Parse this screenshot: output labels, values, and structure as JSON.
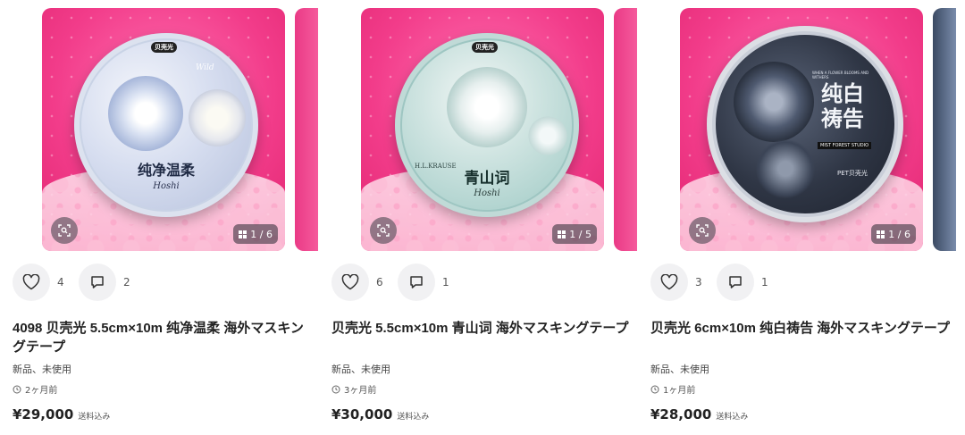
{
  "items": [
    {
      "likes": "4",
      "comments": "2",
      "title": "4098 贝壳光 5.5cm×10m 纯净温柔 海外マスキングテープ",
      "condition": "新品、未使用",
      "time_ago": "2ヶ月前",
      "price": "¥29,000",
      "shipping": "送料込み",
      "image_counter": "1 / 6",
      "tape": {
        "brand": "贝壳光",
        "title": "纯净温柔",
        "script": "Hoshi",
        "extra": "Wild"
      }
    },
    {
      "likes": "6",
      "comments": "1",
      "title": "贝壳光 5.5cm×10m 青山词 海外マスキングテープ",
      "condition": "新品、未使用",
      "time_ago": "3ヶ月前",
      "price": "¥30,000",
      "shipping": "送料込み",
      "image_counter": "1 / 5",
      "tape": {
        "brand": "贝壳光",
        "title": "青山词",
        "script": "Hoshi",
        "extra": "H.L.KRAUSE"
      }
    },
    {
      "likes": "3",
      "comments": "1",
      "title": "贝壳光 6cm×10m 纯白祷告 海外マスキングテープ",
      "condition": "新品、未使用",
      "time_ago": "1ヶ月前",
      "price": "¥28,000",
      "shipping": "送料込み",
      "image_counter": "1 / 6",
      "tape": {
        "brand": "贝壳光",
        "title": "纯白祷告",
        "script": "MIST FOREST STUDIO",
        "extra": "PET贝壳光",
        "small_text": "WHEN A FLOWER BLOOMS AND WITHERS"
      }
    }
  ],
  "colors": {
    "accent_pink": "#f23c8a",
    "text": "#222222",
    "muted": "#555555",
    "button_bg": "#f1f1f3"
  },
  "icons": {
    "like": "heart-icon",
    "comment": "comment-icon",
    "zoom": "image-search-icon",
    "gallery": "grid-icon",
    "clock": "clock-icon"
  }
}
